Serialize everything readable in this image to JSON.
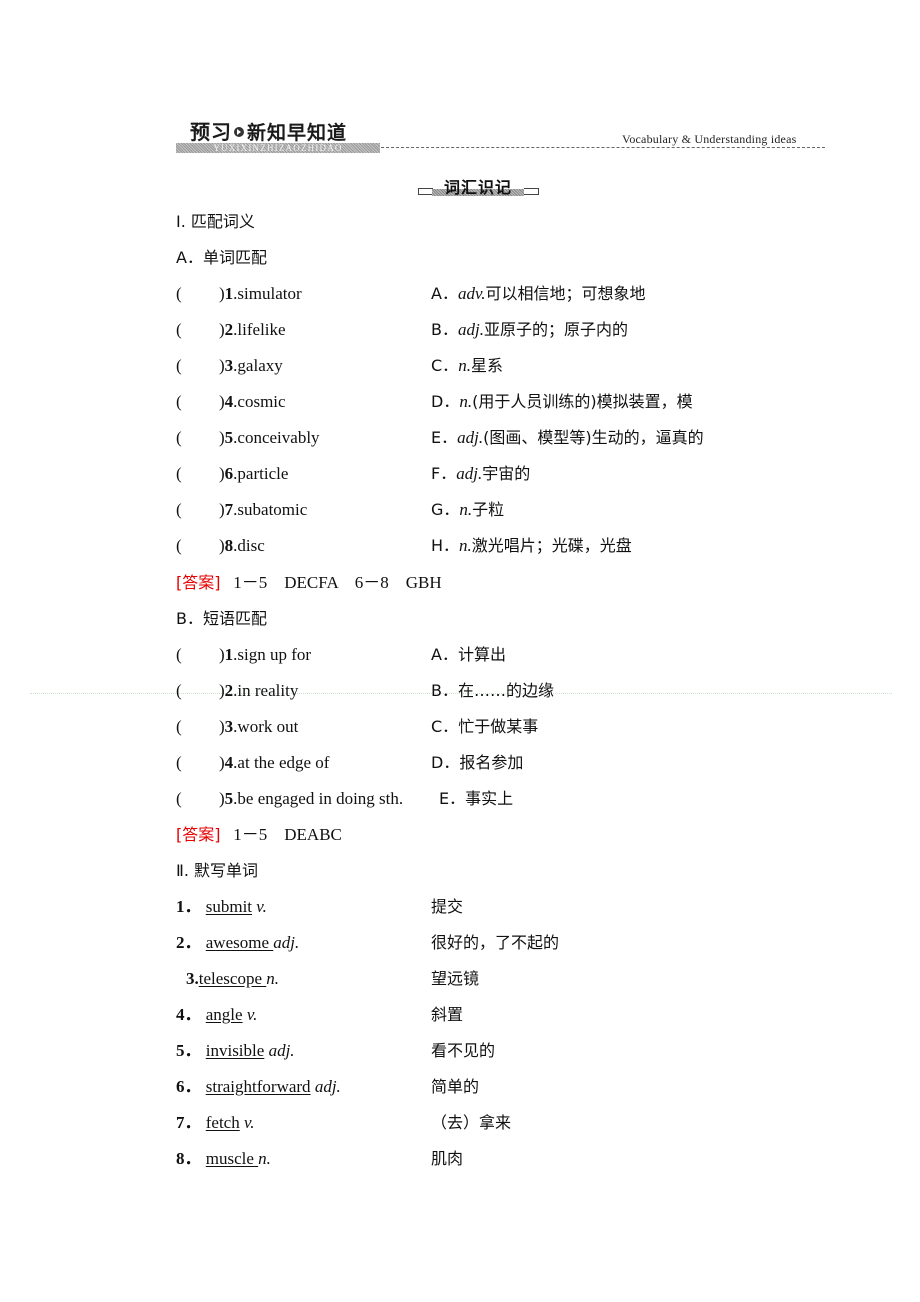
{
  "header": {
    "title_big": "预习",
    "title_rest": "新知早知道",
    "pinyin_band": "YUXIXINZHIZAOZHIDAO",
    "subtitle": "Vocabulary & Understanding ideas"
  },
  "section_badge": "词汇识记",
  "part1": {
    "heading": "Ⅰ. 匹配词义",
    "subA": {
      "heading": "A．单词匹配",
      "items": [
        {
          "num": "1",
          "word": ".simulator",
          "opt": "A．",
          "pos": "adv.",
          "def": "可以相信地；可想象地"
        },
        {
          "num": "2",
          "word": ".lifelike",
          "opt": "B．",
          "pos": "adj.",
          "def": "亚原子的；原子内的"
        },
        {
          "num": "3",
          "word": ".galaxy",
          "opt": "C．",
          "pos": "n.",
          "def": "星系"
        },
        {
          "num": "4",
          "word": ".cosmic",
          "opt": "D．",
          "pos": "n.",
          "def": "(用于人员训练的)模拟装置，模"
        },
        {
          "num": "5",
          "word": ".conceivably",
          "opt": "E．",
          "pos": "adj.",
          "def": "(图画、模型等)生动的，逼真的"
        },
        {
          "num": "6",
          "word": ".particle",
          "opt": "F．",
          "pos": "adj.",
          "def": "宇宙的"
        },
        {
          "num": "7",
          "word": ".subatomic",
          "opt": "G．",
          "pos": "n.",
          "def": "子粒"
        },
        {
          "num": "8",
          "word": ".disc",
          "opt": "H．",
          "pos": "n.",
          "def": "激光唱片；光碟，光盘"
        }
      ],
      "answer_label": "[答案]",
      "answer_text": "1－5　DECFA　6－8　GBH"
    },
    "subB": {
      "heading": "B．短语匹配",
      "items": [
        {
          "num": "1",
          "phrase": ".sign up for",
          "opt": "A．",
          "def": "计算出"
        },
        {
          "num": "2",
          "phrase": ".in reality",
          "opt": "B．",
          "def": "在……的边缘"
        },
        {
          "num": "3",
          "phrase": ".work out",
          "opt": "C．",
          "def": "忙于做某事"
        },
        {
          "num": "4",
          "phrase": ".at the edge of",
          "opt": "D．",
          "def": "报名参加"
        },
        {
          "num": "5",
          "phrase": ".be engaged in doing sth.",
          "opt": "E．",
          "def": "事实上"
        }
      ],
      "answer_label": "[答案]",
      "answer_text": "1－5　DEABC"
    }
  },
  "part2": {
    "heading": "Ⅱ. 默写单词",
    "items": [
      {
        "num": "1．",
        "word": "submit",
        "pos": "v.",
        "meaning": "提交"
      },
      {
        "num": "2．",
        "word": "awesome ",
        "pos": "adj.",
        "meaning": "很好的，了不起的"
      },
      {
        "num": "3.",
        "word": "telescope ",
        "pos": "n.",
        "meaning": "望远镜"
      },
      {
        "num": "4．",
        "word": "angle",
        "pos": "v.",
        "meaning": "斜置"
      },
      {
        "num": "5．",
        "word": "invisible",
        "pos": "adj.",
        "meaning": "看不见的"
      },
      {
        "num": "6．",
        "word": "straightforward",
        "pos": "adj.",
        "meaning": "简单的"
      },
      {
        "num": "7．",
        "word": "fetch",
        "pos": "v.",
        "meaning": "（去）拿来"
      },
      {
        "num": "8．",
        "word": "muscle ",
        "pos": "n.",
        "meaning": "肌肉"
      }
    ]
  }
}
